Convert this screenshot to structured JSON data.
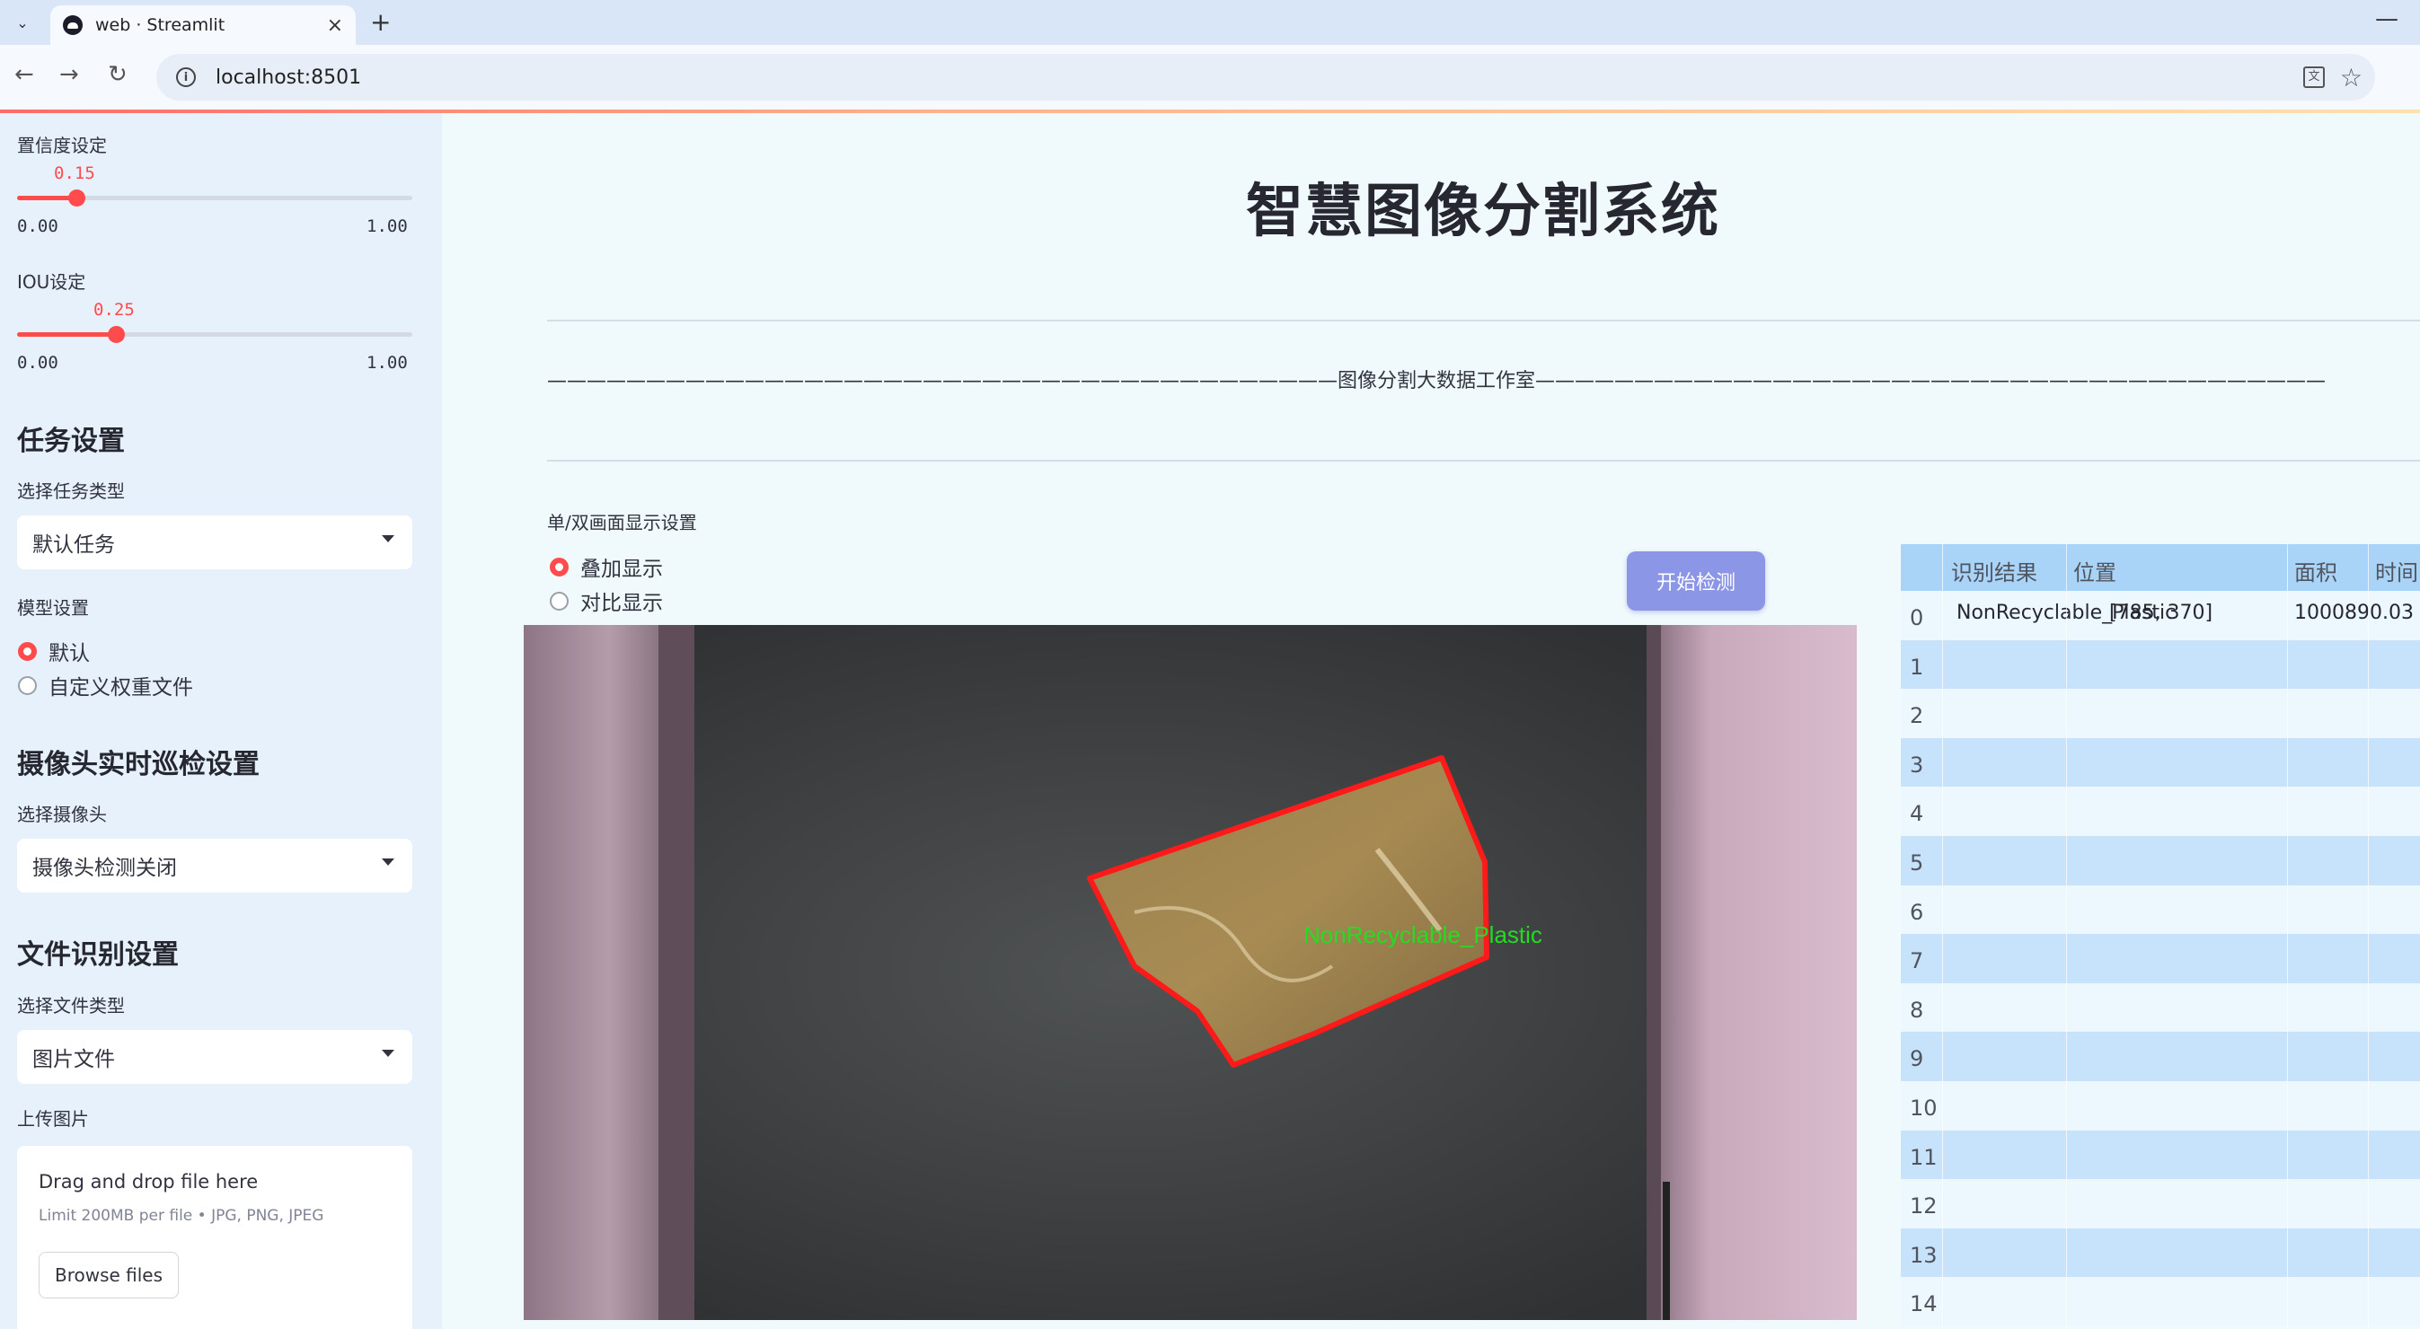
{
  "browser": {
    "tab_title": "web · Streamlit",
    "tab_close": "×",
    "new_tab": "+",
    "minimize": "—",
    "url": "localhost:8501",
    "back": "←",
    "forward": "→",
    "reload": "↻",
    "info": "i",
    "translate": "文",
    "bookmark": "☆",
    "dropdown": "⌄"
  },
  "sidebar": {
    "confidence": {
      "label": "置信度设定",
      "value": "0.15",
      "value_fraction": 0.15,
      "min": "0.00",
      "max": "1.00"
    },
    "iou": {
      "label": "IOU设定",
      "value": "0.25",
      "value_fraction": 0.25,
      "min": "0.00",
      "max": "1.00"
    },
    "task_heading": "任务设置",
    "task_type_label": "选择任务类型",
    "task_type_value": "默认任务",
    "model_label": "模型设置",
    "model_options": [
      "默认",
      "自定义权重文件"
    ],
    "model_selected": 0,
    "camera_heading": "摄像头实时巡检设置",
    "camera_label": "选择摄像头",
    "camera_value": "摄像头检测关闭",
    "file_heading": "文件识别设置",
    "file_type_label": "选择文件类型",
    "file_type_value": "图片文件",
    "upload_label": "上传图片",
    "uploader": {
      "title": "Drag and drop file here",
      "subtitle": "Limit 200MB per file • JPG, PNG, JPEG",
      "button": "Browse files"
    }
  },
  "main": {
    "title": "智慧图像分割系统",
    "studio_line": "————————————————————————————————————————图像分割大数据工作室————————————————————————————————————————",
    "display_mode_label": "单/双画面显示设置",
    "display_options": [
      "叠加显示",
      "对比显示"
    ],
    "display_selected": 0,
    "start_button": "开始检测",
    "detection_label": "NonRecyclable_Plastic",
    "colors": {
      "mask_outline": "#ff1a1a",
      "label_text": "#22dd22",
      "accent": "#ff4b4b"
    }
  },
  "results_table": {
    "columns": [
      "识别结果",
      "位置",
      "面积",
      "时间"
    ],
    "row_indices": [
      "0",
      "1",
      "2",
      "3",
      "4",
      "5",
      "6",
      "7",
      "8",
      "9",
      "10",
      "11",
      "12",
      "13",
      "14"
    ],
    "rows": [
      {
        "result": "NonRecyclable_Plastic",
        "position": "[785, 370]",
        "area": "1000890.03",
        "time": ""
      }
    ]
  }
}
